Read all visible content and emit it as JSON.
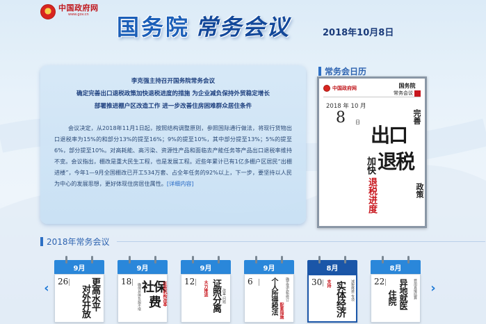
{
  "header": {
    "site_name": "中国政府网",
    "site_url": "www.gov.cn",
    "title_part1": "国务院",
    "title_part2": "常务会议",
    "date": "2018年10月8日"
  },
  "summary": {
    "heading": [
      "李克强主持召开国务院常务会议",
      "确定完善出口退税政策加快退税进度的措施 为企业减负保持外贸稳定增长",
      "部署推进棚户区改造工作 进一步改善住房困难群众居住条件"
    ],
    "body": "会议决定，从2018年11月1日起，按照结构调整原则，参照国际通行做法，将现行货物出口退税率为15%的和部分13%的提至16%；9%的提至10%，其中部分提至13%；5%的提至6%，部分提至10%。对高耗能、高污染、资源性产品和面临去产能任务等产品出口退税率维持不变。会议指出，棚改是重大民生工程，也是发展工程。近些年累计已有1亿多棚户区居民“出棚进楼”，今年1—9月全国棚改已开工534万套、占全年任务的92%以上，下一步，要坚持以人民为中心的发展思想，更好体现住房居住属性。",
    "more_link": "[详细内容]"
  },
  "calendar": {
    "title": "常务会日历",
    "site_name": "中国政府网",
    "brand_line1": "国务院",
    "brand_line2": "常务会议",
    "year_month": "2018 年 10 月",
    "day": "8",
    "day_unit": "日",
    "chars_wansan": "完善",
    "chars_main1": "出口",
    "chars_main2": "退税",
    "chars_jiakuai": "加快",
    "chars_red": "退税进度",
    "chars_zhengce": "政策"
  },
  "meetings": {
    "title": "2018年常务会议",
    "prev_arrow": "‹",
    "next_arrow": "›",
    "cards": [
      {
        "month": "9月",
        "day": "26",
        "big1": "更高水平",
        "big2": "对外开放",
        "small": "",
        "red": "",
        "active": false
      },
      {
        "month": "9月",
        "day": "18",
        "big1": "社保",
        "big2": "费",
        "small": "确保总体负担不增",
        "red": "征收机构改革",
        "active": false
      },
      {
        "month": "9月",
        "day": "12",
        "big1": "证照分离",
        "big2": "",
        "small": "改革 问题",
        "red": "大力推进",
        "active": false
      },
      {
        "month": "9月",
        "day": "6",
        "big1": "个人所得税法",
        "big2": "",
        "small": "确定落实新修订",
        "red": "配套措施",
        "active": false
      },
      {
        "month": "8月",
        "day": "30",
        "big1": "实体经济",
        "big2": "",
        "small": "减税降费 专项",
        "red": "支持",
        "active": true
      },
      {
        "month": "8月",
        "day": "22",
        "big1": "异地就医",
        "big2": "住院",
        "small": "费用直接结算",
        "red": "",
        "active": false
      }
    ]
  }
}
